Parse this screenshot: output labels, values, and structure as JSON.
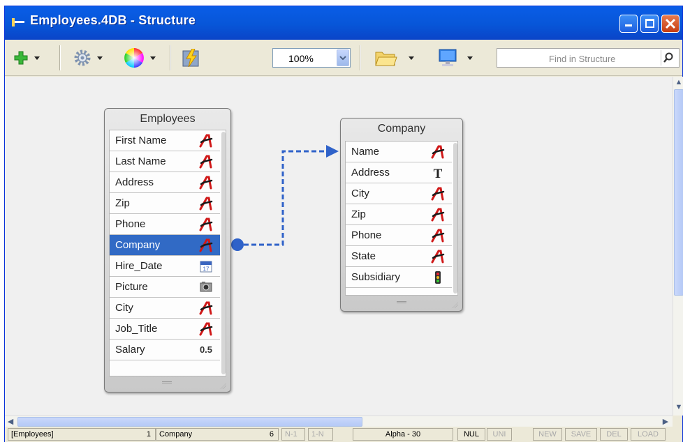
{
  "window": {
    "title": "Employees.4DB - Structure"
  },
  "toolbar": {
    "zoom_value": "100%",
    "search_placeholder": "Find in Structure",
    "icons": [
      "add-icon",
      "gear-icon",
      "color-wheel-icon",
      "compile-icon",
      "folder-icon",
      "monitor-icon",
      "search-icon"
    ]
  },
  "tables": {
    "employees": {
      "name": "Employees",
      "fields": [
        {
          "label": "First Name",
          "type": "alpha"
        },
        {
          "label": "Last Name",
          "type": "alpha"
        },
        {
          "label": "Address",
          "type": "alpha"
        },
        {
          "label": "Zip",
          "type": "alpha"
        },
        {
          "label": "Phone",
          "type": "alpha"
        },
        {
          "label": "Company",
          "type": "alpha",
          "selected": true
        },
        {
          "label": "Hire_Date",
          "type": "date",
          "icon_text": "17"
        },
        {
          "label": "Picture",
          "type": "picture"
        },
        {
          "label": "City",
          "type": "alpha"
        },
        {
          "label": "Job_Title",
          "type": "alpha"
        },
        {
          "label": "Salary",
          "type": "real",
          "icon_text": "0.5"
        }
      ]
    },
    "company": {
      "name": "Company",
      "fields": [
        {
          "label": "Name",
          "type": "alpha"
        },
        {
          "label": "Address",
          "type": "text",
          "icon_text": "T"
        },
        {
          "label": "City",
          "type": "alpha"
        },
        {
          "label": "Zip",
          "type": "alpha"
        },
        {
          "label": "Phone",
          "type": "alpha"
        },
        {
          "label": "State",
          "type": "alpha"
        },
        {
          "label": "Subsidiary",
          "type": "boolean"
        }
      ]
    }
  },
  "relation": {
    "from": "Employees.Company",
    "to": "Company.Name"
  },
  "statusbar": {
    "table": "[Employees]",
    "table_num": "1",
    "field": "Company",
    "field_num": "6",
    "n1": "N-1",
    "one_n": "1-N",
    "type": "Alpha - 30",
    "nul": "NUL",
    "uni": "UNI",
    "new": "NEW",
    "save": "SAVE",
    "del": "DEL",
    "load": "LOAD"
  },
  "colors": {
    "title_bar": "#0756d8",
    "selection": "#316ac5",
    "relation_line": "#2f62c9",
    "alpha_icon": "#d01818"
  }
}
